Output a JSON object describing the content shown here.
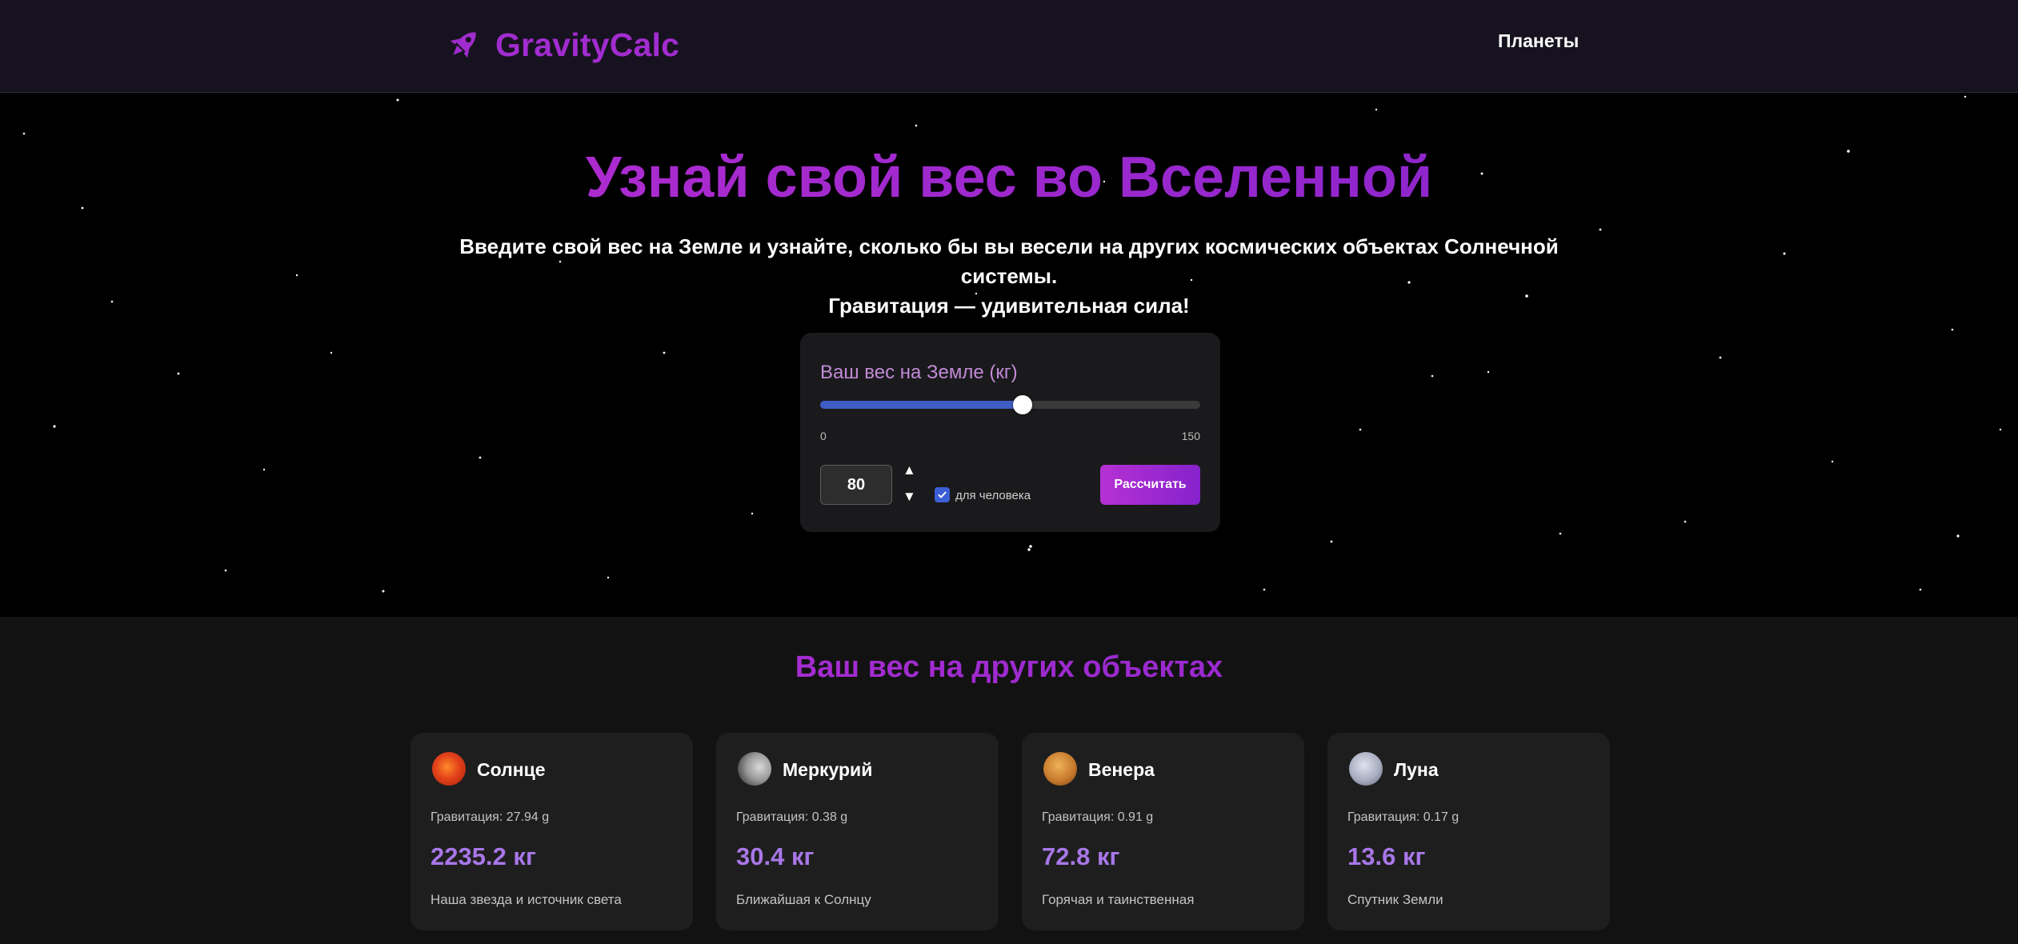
{
  "nav": {
    "brand": "GravityCalc",
    "brand_icon": "rocket-icon",
    "brand_color": "#a12ccf",
    "link_planets": "Планеты"
  },
  "hero": {
    "title": "Узнай свой вес во Вселенной",
    "subtitle_line1": "Введите свой вес на Земле и узнайте, сколько бы вы весели на других космических объектах Солнечной системы.",
    "subtitle_line2": "Гравитация — удивительная сила!"
  },
  "calculator": {
    "label": "Ваш вес на Земле (кг)",
    "slider_min": "0",
    "slider_max": "150",
    "slider_value_fraction": 0.533,
    "weight_value": "80",
    "human_checkbox_label": "для человека",
    "human_checked": true,
    "calculate_label": "Рассчитать",
    "accent_color": "#3d5cc4"
  },
  "results": {
    "title": "Ваш вес на других объектах",
    "cards": [
      {
        "name": "Солнце",
        "icon": "sun-icon",
        "gravity": "Гравитация: 27.94 g",
        "weight": "2235.2 кг",
        "desc": "Наша звезда и источник света"
      },
      {
        "name": "Меркурий",
        "icon": "mercury-icon",
        "gravity": "Гравитация: 0.38 g",
        "weight": "30.4 кг",
        "desc": "Ближайшая к Солнцу"
      },
      {
        "name": "Венера",
        "icon": "venus-icon",
        "gravity": "Гравитация: 0.91 g",
        "weight": "72.8 кг",
        "desc": "Горячая и таинственная"
      },
      {
        "name": "Луна",
        "icon": "moon-icon",
        "gravity": "Гравитация: 0.17 g",
        "weight": "13.6 кг",
        "desc": "Спутник Земли"
      }
    ],
    "weight_color": "#a877e8"
  }
}
